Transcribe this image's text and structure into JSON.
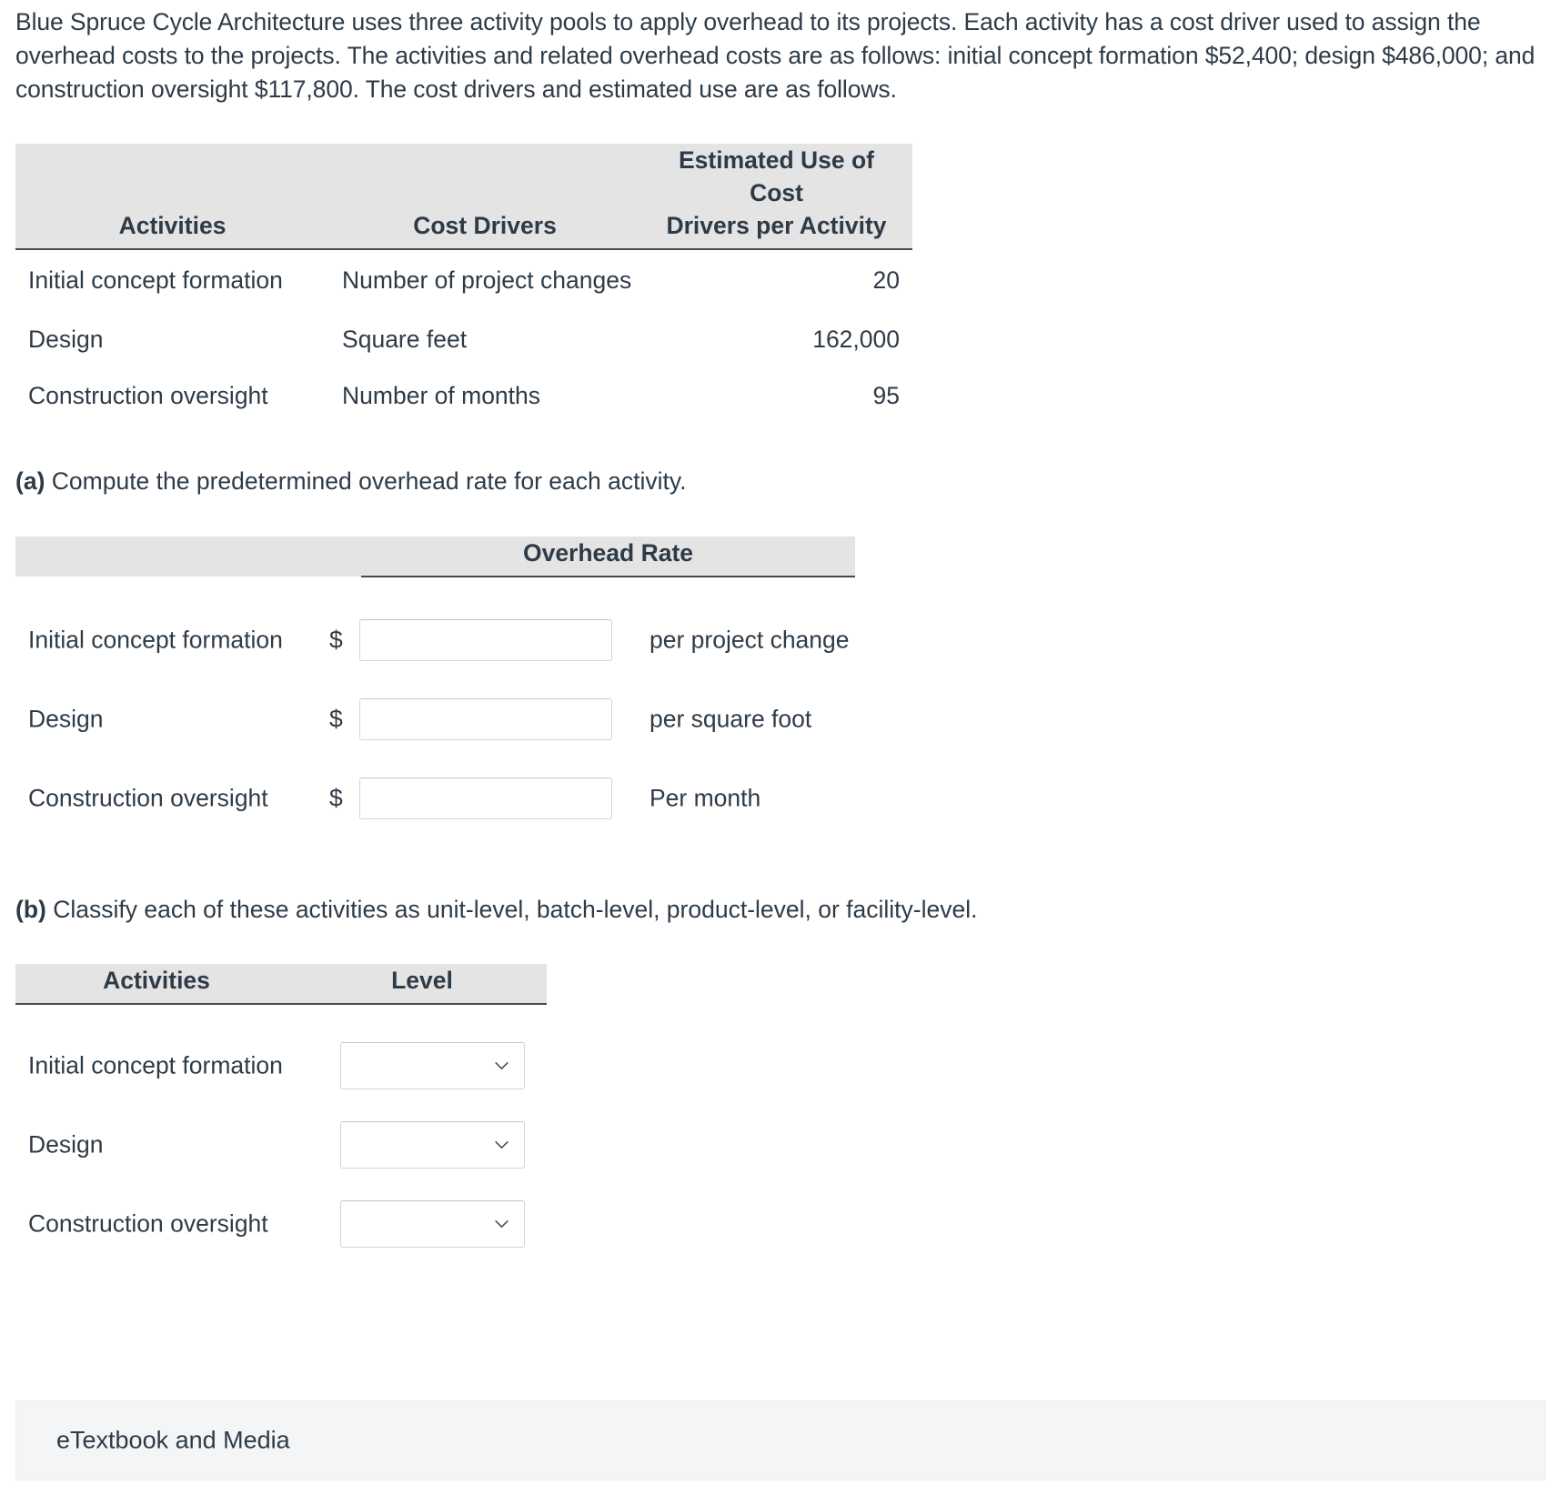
{
  "intro": {
    "text": "Blue Spruce Cycle Architecture uses three activity pools to apply overhead to its projects. Each activity has a cost driver used to assign the overhead costs to the projects. The activities and related overhead costs are as follows: initial concept formation $52,400; design $486,000; and construction oversight $117,800. The cost drivers and estimated use are as follows."
  },
  "cost_driver_table": {
    "headers": {
      "activities": "Activities",
      "cost_drivers": "Cost Drivers",
      "estimated_use_line1": "Estimated Use of Cost",
      "estimated_use_line2": "Drivers per Activity"
    },
    "rows": [
      {
        "activity": "Initial concept formation",
        "driver": "Number of project changes",
        "estimated_use": "20"
      },
      {
        "activity": "Design",
        "driver": "Square feet",
        "estimated_use": "162,000"
      },
      {
        "activity": "Construction oversight",
        "driver": "Number of months",
        "estimated_use": "95"
      }
    ]
  },
  "part_a": {
    "label": "(a)",
    "prompt": "Compute the predetermined overhead rate for each activity.",
    "header_overhead_rate": "Overhead Rate",
    "currency_symbol": "$",
    "input_placeholder": "",
    "rows": [
      {
        "activity": "Initial concept formation",
        "value": "",
        "unit": "per project change"
      },
      {
        "activity": "Design",
        "value": "",
        "unit": "per square foot"
      },
      {
        "activity": "Construction oversight",
        "value": "",
        "unit": "Per month"
      }
    ]
  },
  "part_b": {
    "label": "(b)",
    "prompt": "Classify each of these activities as unit-level, batch-level, product-level, or facility-level.",
    "headers": {
      "activities": "Activities",
      "level": "Level"
    },
    "rows": [
      {
        "activity": "Initial concept formation",
        "level": ""
      },
      {
        "activity": "Design",
        "level": ""
      },
      {
        "activity": "Construction oversight",
        "level": ""
      }
    ],
    "chevron_icon": "chevron-down-icon"
  },
  "footer": {
    "etextbook_label": "eTextbook and Media"
  },
  "colors": {
    "text": "#2e3b47",
    "table_header_bg": "#e4e4e4",
    "rule": "#4a4a4a",
    "field_border": "#d4d4d4",
    "footer_bg": "#f4f5f6"
  }
}
